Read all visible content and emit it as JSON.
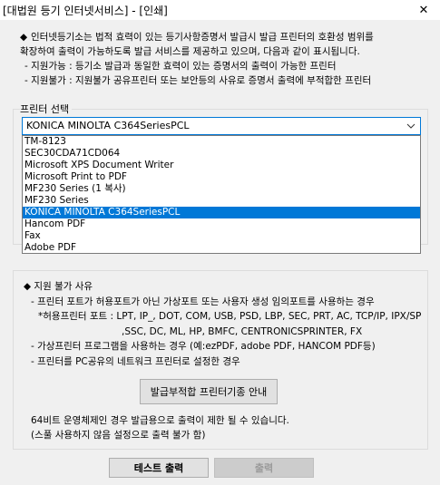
{
  "window": {
    "title": "[대법원 등기 인터넷서비스] - [인쇄]",
    "close_glyph": "✕"
  },
  "intro": {
    "bullet": "◆",
    "line1": "인터넷등기소는 법적 효력이 있는 등기사항증명서 발급시 발급 프린터의 호환성 범위를",
    "line2": "확장하여 출력이 가능하도록 발급 서비스를 제공하고 있으며, 다음과 같이 표시됩니다.",
    "line3": "- 지원가능 : 등기소 발급과 동일한 효력이 있는 증명서의 출력이 가능한 프린터",
    "line4": "- 지원불가 : 지원불가 공유프린터 또는 보안등의 사유로 증명서 출력에 부적합한 프린터"
  },
  "printer_select": {
    "label": "프린터 선택",
    "selected": "KONICA MINOLTA C364SeriesPCL",
    "options": [
      "TM-8123",
      "SEC30CDA71CD064",
      "Microsoft XPS Document Writer",
      "Microsoft Print to PDF",
      "MF230 Series (1 복사)",
      "MF230 Series",
      "KONICA MINOLTA C364SeriesPCL",
      "Hancom PDF",
      "Fax",
      "Adobe PDF"
    ]
  },
  "unsupported": {
    "heading": "◆ 지원 불가 사유",
    "line1": "- 프린터 포트가 허용포트가 아닌 가상포트 또는 사용자 생성 임의포트를 사용하는 경우",
    "line2": "*허용프린터 포트 : LPT, IP_, DOT, COM, USB, PSD, LBP, SEC, PRT, AC, TCP/IP, IPX/SP",
    "line3": ",SSC, DC, ML, HP, BMFC, CENTRONICSPRINTER, FX",
    "line4": "- 가상프린터 프로그램을 사용하는 경우 (예:ezPDF, adobe PDF, HANCOM PDF등)",
    "line5": "- 프린터를 PC공유의 네트워크 프린터로 설정한 경우",
    "guide_button": "발급부적합 프린터기종 안내"
  },
  "note": {
    "line1": "64비트 운영체제인 경우 발급용으로 출력이 제한 될 수 있습니다.",
    "line2": "(스풀 사용하지 않음 설정으로 출력 불가 함)"
  },
  "buttons": {
    "test_print": "테스트 출력",
    "print": "출력"
  }
}
